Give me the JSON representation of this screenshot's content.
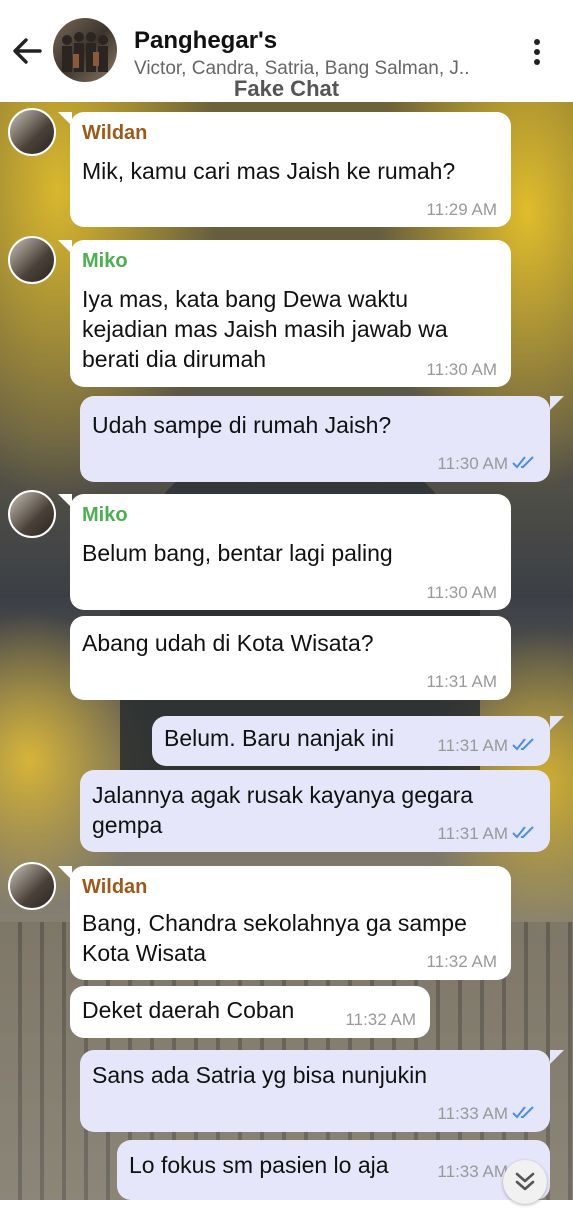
{
  "header": {
    "title": "Panghegar's",
    "subtitle": "Victor, Candra, Satria, Bang Salman, J..",
    "watermark": "Fake Chat"
  },
  "colors": {
    "outgoing_bubble": "#e5e6fa",
    "incoming_bubble": "#ffffff",
    "wildan_name": "#9c5a1a",
    "miko_name": "#4caf50",
    "read_ticks": "#4a8ee8"
  },
  "messages": [
    {
      "sender": "Wildan",
      "text": [
        "Mik, kamu cari mas Jaish ke rumah?"
      ],
      "time": "11:29 AM"
    },
    {
      "sender": "Miko",
      "text": [
        "Iya mas, kata bang Dewa waktu",
        "kejadian mas Jaish masih jawab wa",
        "berati dia dirumah"
      ],
      "time": "11:30 AM"
    },
    {
      "text": [
        "Udah sampe di rumah Jaish?"
      ],
      "time": "11:30 AM"
    },
    {
      "sender": "Miko",
      "text": [
        "Belum bang, bentar lagi paling"
      ],
      "time": "11:30 AM"
    },
    {
      "text": [
        "Abang udah di Kota Wisata?"
      ],
      "time": "11:31 AM"
    },
    {
      "text": [
        "Belum. Baru nanjak ini"
      ],
      "time": "11:31 AM"
    },
    {
      "text": [
        "Jalannya agak rusak kayanya gegara",
        "gempa"
      ],
      "time": "11:31 AM"
    },
    {
      "sender": "Wildan",
      "text": [
        "Bang, Chandra sekolahnya ga sampe",
        "Kota Wisata"
      ],
      "time": "11:32 AM"
    },
    {
      "text": [
        "Deket daerah Coban"
      ],
      "time": "11:32 AM"
    },
    {
      "text": [
        "Sans ada Satria yg bisa nunjukin"
      ],
      "time": "11:33 AM"
    },
    {
      "text": [
        "Lo fokus sm pasien lo aja"
      ],
      "time": "11:33 AM"
    }
  ]
}
